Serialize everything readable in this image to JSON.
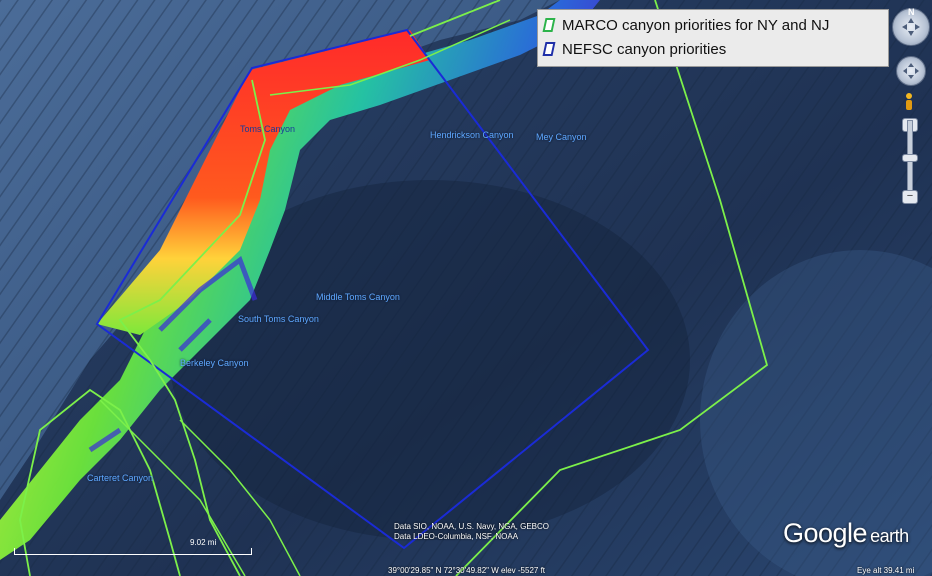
{
  "legend": {
    "items": [
      {
        "label": "MARCO canyon priorities for NY and NJ",
        "color": "#2cb34a"
      },
      {
        "label": "NEFSC canyon priorities",
        "color": "#1f2fa8"
      }
    ]
  },
  "canyon_labels": [
    "Toms Canyon",
    "Hendrickson Canyon",
    "Mey Canyon",
    "Middle Toms Canyon",
    "South Toms Canyon",
    "Berkeley Canyon",
    "Carteret Canyon"
  ],
  "scale": {
    "label": "9.02 mi"
  },
  "credits": {
    "line1": "Data SIO, NOAA, U.S. Navy, NGA, GEBCO",
    "line2": "Data LDEO-Columbia, NSF, NOAA"
  },
  "status": {
    "coords": "39°00'29.85\" N  72°30'49.82\" W  elev -5527 ft",
    "eye_alt": "Eye alt   39.41 mi"
  },
  "logo": {
    "brand": "Google",
    "product": "earth"
  },
  "compass": {
    "north": "N"
  },
  "colors": {
    "marco_outline": "#7cf04a",
    "nefsc_outline": "#1a2bd6",
    "shelf": "#3f5f8a",
    "deep": "#233a5e"
  },
  "icons": [
    "compass-icon",
    "look-joystick-icon",
    "street-view-icon",
    "zoom-in-icon",
    "zoom-out-icon"
  ]
}
